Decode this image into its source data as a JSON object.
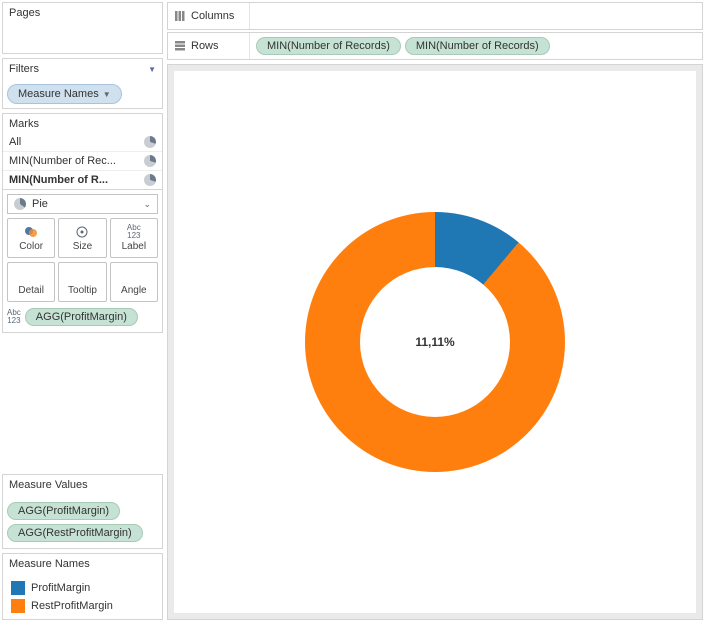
{
  "chart_data": {
    "type": "pie",
    "series": [
      {
        "name": "ProfitMargin",
        "value": 11.11,
        "color": "#1f77b4"
      },
      {
        "name": "RestProfitMargin",
        "value": 88.89,
        "color": "#ff7f0e"
      }
    ],
    "center_label": "11,11%"
  },
  "pages": {
    "title": "Pages"
  },
  "filters": {
    "title": "Filters",
    "pill": "Measure Names"
  },
  "marks": {
    "title": "Marks",
    "rows": [
      {
        "label": "All"
      },
      {
        "label": "MIN(Number of Rec..."
      },
      {
        "label": "MIN(Number of R..."
      }
    ],
    "mark_type": "Pie",
    "buttons_row1": [
      {
        "label": "Color"
      },
      {
        "label": "Size"
      },
      {
        "label": "Label"
      }
    ],
    "buttons_row2": [
      {
        "label": "Detail"
      },
      {
        "label": "Tooltip"
      },
      {
        "label": "Angle"
      }
    ],
    "label_pill": "AGG(ProfitMargin)"
  },
  "measure_values": {
    "title": "Measure Values",
    "items": [
      "AGG(ProfitMargin)",
      "AGG(RestProfitMargin)"
    ]
  },
  "measure_names": {
    "title": "Measure Names",
    "items": [
      {
        "label": "ProfitMargin",
        "color": "#1f77b4"
      },
      {
        "label": "RestProfitMargin",
        "color": "#ff7f0e"
      }
    ]
  },
  "shelves": {
    "columns_label": "Columns",
    "rows_label": "Rows",
    "rows_pills": [
      "MIN(Number of Records)",
      "MIN(Number of Records)"
    ]
  }
}
